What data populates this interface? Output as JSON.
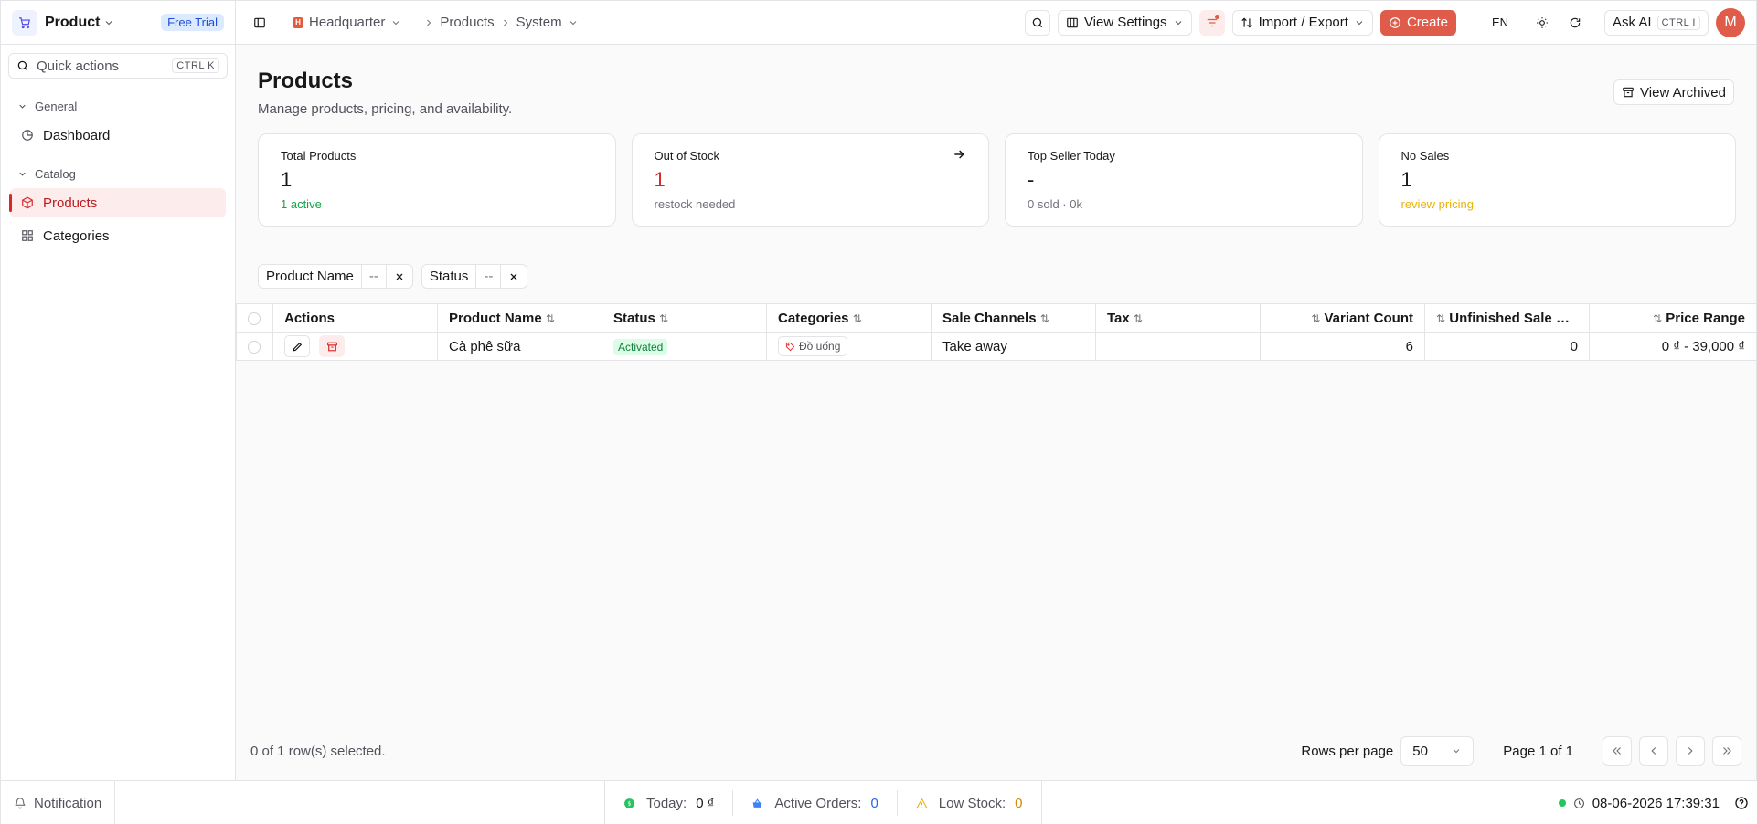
{
  "sidebar": {
    "app_name": "Product",
    "trial_badge": "Free Trial",
    "quick_actions": "Quick actions",
    "quick_kbd": "CTRL K",
    "groups": [
      {
        "label": "General",
        "items": [
          {
            "label": "Dashboard",
            "icon": "dashboard-icon"
          }
        ]
      },
      {
        "label": "Catalog",
        "items": [
          {
            "label": "Products",
            "icon": "box-icon",
            "active": true
          },
          {
            "label": "Categories",
            "icon": "grid-icon"
          }
        ]
      }
    ]
  },
  "topbar": {
    "breadcrumb": [
      "Headquarter",
      "Products",
      "System"
    ],
    "view_settings": "View Settings",
    "import_export": "Import / Export",
    "create": "Create",
    "lang": "EN",
    "ask_ai": "Ask AI",
    "ask_ai_kbd": "CTRL I",
    "avatar": "M"
  },
  "page": {
    "title": "Products",
    "subtitle": "Manage products, pricing, and availability.",
    "view_archived": "View Archived"
  },
  "cards": [
    {
      "label": "Total Products",
      "value": "1",
      "sub": "1 active",
      "sub_color": "#16a34a"
    },
    {
      "label": "Out of Stock",
      "value": "1",
      "value_color": "#dc2626",
      "sub": "restock needed"
    },
    {
      "label": "Top Seller Today",
      "value": "-",
      "sub": "0 sold · 0k"
    },
    {
      "label": "No Sales",
      "value": "1",
      "sub": "review pricing",
      "sub_color": "#eab308"
    }
  ],
  "filters": [
    {
      "label": "Product Name",
      "value": "--"
    },
    {
      "label": "Status",
      "value": "--"
    }
  ],
  "table": {
    "headers": [
      "Actions",
      "Product Name",
      "Status",
      "Categories",
      "Sale Channels",
      "Tax",
      "Variant Count",
      "Unfinished Sale O...",
      "Price Range"
    ],
    "rows": [
      {
        "name": "Cà phê sữa",
        "status": "Activated",
        "category": "Đồ uống",
        "channel": "Take away",
        "tax": "",
        "variants": "6",
        "unfinished": "0",
        "price": "0 ₫ - 39,000 ₫"
      }
    ]
  },
  "footer": {
    "selected": "0 of 1 row(s) selected.",
    "rows_per_page_label": "Rows per page",
    "rows_per_page": "50",
    "page_info": "Page 1 of 1"
  },
  "statusbar": {
    "notification": "Notification",
    "today_label": "Today:",
    "today_value": "0 ₫",
    "orders_label": "Active Orders:",
    "orders_value": "0",
    "low_stock_label": "Low Stock:",
    "low_stock_value": "0",
    "datetime": "08-06-2026 17:39:31"
  }
}
